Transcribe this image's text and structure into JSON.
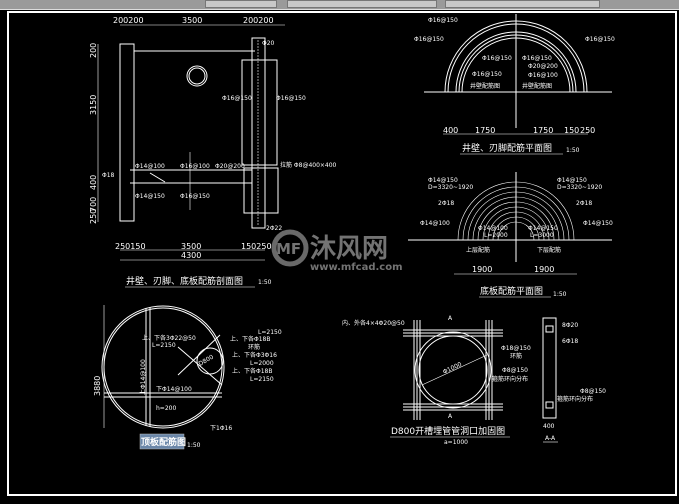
{
  "colors": {
    "background": "#000000",
    "lines": "#ffffff",
    "selection": "#6a86a8",
    "watermark": "#8c8c8c"
  },
  "watermark": {
    "brand": "沐风网",
    "url": "www.mfcad.com",
    "logo_text": "MF"
  },
  "section": {
    "dims_top": [
      "200200",
      "3500",
      "200200"
    ],
    "dims_left": [
      "200",
      "3150",
      "400",
      "700",
      "250"
    ],
    "dims_bottom": [
      "250150",
      "3500",
      "150250"
    ],
    "total": "4300",
    "labels": [
      "Φ20",
      "Φ16@150",
      "Φ16@150",
      "Φ16@150",
      "Φ16@150",
      "Φ14@100",
      "Φ16@100",
      "Φ20@200",
      "拉筋 Φ8@400×400",
      "Φ18",
      "Φ14@150",
      "Φ16@150",
      "Φ16@100",
      "Φ16@100",
      "2Φ22"
    ],
    "title": "井壁、刃脚、底板配筋剖面图",
    "scale": "1:50"
  },
  "wall_plan": {
    "labels": [
      "Φ16@150",
      "Φ16@150",
      "Φ16@150",
      "Φ16@150",
      "Φ16@150",
      "Φ20@200",
      "Φ16@100",
      "Φ16@150"
    ],
    "sub_left": "井壁配筋图",
    "sub_right": "井壁配筋图",
    "dims": [
      "400",
      "1750",
      "1750",
      "150",
      "250"
    ],
    "title": "井壁、刃脚配筋平面图",
    "scale": "1:50"
  },
  "base_plan": {
    "left_top": "Φ14@150",
    "left_top2": "D=3320~1920",
    "right_top": "Φ14@150",
    "right_top2": "D=3320~1920",
    "left_mid": "2Φ18",
    "right_mid": "2Φ18",
    "left_low": "Φ14@100",
    "right_low": "Φ14@150",
    "inner_left": "Φ14@100",
    "inner_left2": "L=2000",
    "inner_right": "Φ14@150",
    "inner_right2": "L=3000",
    "sub_left": "上层配筋",
    "sub_right": "下层配筋",
    "dims": [
      "1900",
      "1900"
    ],
    "title": "底板配筋平面图",
    "scale": "1:50"
  },
  "roof_plan": {
    "dim": "3880",
    "labels": [
      "上、下各3Φ22@50",
      "L=2150",
      "上Φ14@100",
      "下Φ14@100",
      "h=200",
      "下1Φ16",
      "L=2150",
      "上、下各Φ18B",
      "环筋",
      "上、下各Φ3Φ16",
      "L=2000",
      "上、下各Φ18B",
      "L=2150",
      "D800"
    ],
    "title": "顶板配筋图",
    "scale": "1:50"
  },
  "opening": {
    "labels": [
      "内、外各4×4Φ20@50",
      "A",
      "A",
      "Φ18@150",
      "环筋",
      "Φ8@150",
      "箍筋环向分布",
      "Φ1000"
    ],
    "title": "D800开槽埋管管洞口加固图",
    "note": "a=1000"
  },
  "section_aa": {
    "labels": [
      "8Φ20",
      "6Φ18",
      "Φ8@150",
      "箍筋环向分布"
    ],
    "dim": "400",
    "title": "A-A"
  }
}
